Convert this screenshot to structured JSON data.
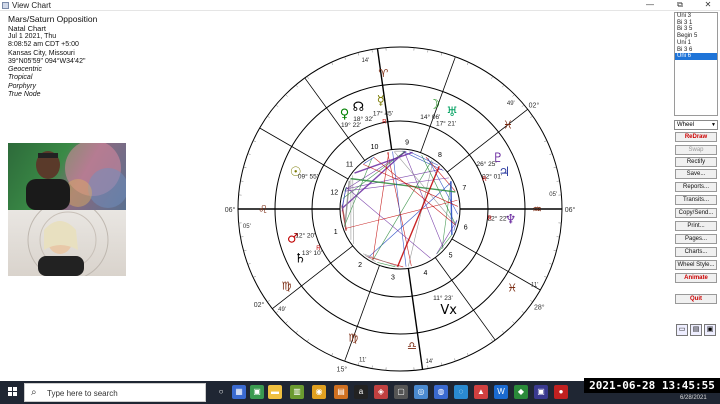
{
  "window": {
    "title": "View Chart",
    "minimize": "—",
    "restore": "⧉",
    "close": "✕"
  },
  "info": {
    "lines": [
      "Mars/Saturn Opposition",
      "Natal Chart",
      "Jul 1 2021, Thu",
      "8:08:52 am  CDT +5:00",
      "Kansas City, Missouri",
      "39°N05'59\" 094°W34'42\""
    ],
    "italic_lines": [
      "Geocentric",
      "Tropical",
      "Porphyry",
      "True Node"
    ]
  },
  "planet_list": {
    "items": [
      "Uni 3",
      "Bi 3 1",
      "Bi 3 5",
      "Begin 5",
      "Uni 1",
      "Bi 3 6",
      "Uni 6"
    ],
    "selected": 6
  },
  "wheel_select": {
    "value": "Wheel"
  },
  "buttons": {
    "redraw": "ReDraw",
    "swap": "Swap",
    "rectify": "Rectify",
    "save": "Save...",
    "reports": "Reports...",
    "transits": "Transits...",
    "copy_send": "Copy/Send...",
    "print": "Print...",
    "pages": "Pages...",
    "charts": "Charts...",
    "wheel_style": "Wheel Style...",
    "animate": "Animate",
    "quit": "Quit"
  },
  "chart": {
    "house_numbers": [
      "1",
      "2",
      "3",
      "4",
      "5",
      "6",
      "7",
      "8",
      "9",
      "10",
      "11",
      "12"
    ],
    "cusps": [
      {
        "deg": "06°",
        "min": "05'",
        "sign": "♌"
      },
      {
        "deg": "23°",
        "min": "14'",
        "sign": "♈"
      },
      {
        "deg": "06°",
        "min": "05'",
        "sign": "♒"
      },
      {
        "deg": "24°",
        "min": "14'",
        "sign": "♎"
      },
      {
        "deg": "02°",
        "min": "49'",
        "sign": "♍"
      },
      {
        "deg": "15°",
        "min": "11'",
        "sign": "♍"
      },
      {
        "deg": "28°",
        "min": "11'",
        "sign": "♓"
      },
      {
        "deg": "02°",
        "min": "49'",
        "sign": "♓"
      }
    ],
    "planet_labels": [
      {
        "glyph": "☉",
        "text": "09° 55'",
        "color": "#7a7a00"
      },
      {
        "glyph": "♂",
        "text": "12° 20'",
        "color": "#c00000"
      },
      {
        "glyph": "♄",
        "text": "13° 10'",
        "color": "#000000"
      },
      {
        "glyph": "♀",
        "text": "19° 22'",
        "color": "#008000"
      },
      {
        "glyph": "☊",
        "text": "18° 32'",
        "color": "#000000"
      },
      {
        "glyph": "☿",
        "text": "17° 45'",
        "color": "#7a7a00"
      },
      {
        "glyph": "♆",
        "text": "22° 22'",
        "color": "#6a2aa0"
      },
      {
        "glyph": "♅",
        "text": "17° 21'",
        "color": "#00a060"
      },
      {
        "glyph": "♇",
        "text": "26° 25'",
        "color": "#6a2aa0"
      },
      {
        "glyph": "♃",
        "text": "02° 01'",
        "color": "#2a3aa0"
      },
      {
        "glyph": "☽",
        "text": "14° 06'",
        "color": "#008000"
      },
      {
        "glyph": "Vx",
        "text": "11° 23'",
        "color": "#000000"
      }
    ],
    "planet_positions": [
      {
        "glyph": "☉",
        "label": "09° 55'",
        "color": "#7a7a00"
      },
      {
        "glyph": "♂",
        "label": "12° 20'",
        "color": "#c00000"
      },
      {
        "glyph": "♄",
        "label": "13° 10'",
        "color": "#000000"
      },
      {
        "glyph": "♀",
        "label": "19° 22'",
        "color": "#008000"
      },
      {
        "glyph": "☊",
        "label": "18° 32'",
        "color": "#000000"
      },
      {
        "glyph": "☿",
        "label": "17° 45'",
        "color": "#7a7a00"
      },
      {
        "glyph": "♆",
        "label": "22° 22'",
        "color": "#6a2aa0"
      },
      {
        "glyph": "♅",
        "label": "17° 21'",
        "color": "#00a060"
      },
      {
        "glyph": "♇",
        "label": "26° 25'",
        "color": "#6a2aa0"
      },
      {
        "glyph": "♃",
        "label": "02° 01'",
        "color": "#2a3aa0"
      },
      {
        "glyph": "☽",
        "label": "14° 06'",
        "color": "#008000"
      },
      {
        "glyph": "Vx",
        "label": "11° 23'",
        "color": "#000000"
      }
    ]
  },
  "taskbar": {
    "search_placeholder": "Type here to search",
    "time": "2021-06-28  13:45:55",
    "date": "6/28/2021"
  }
}
